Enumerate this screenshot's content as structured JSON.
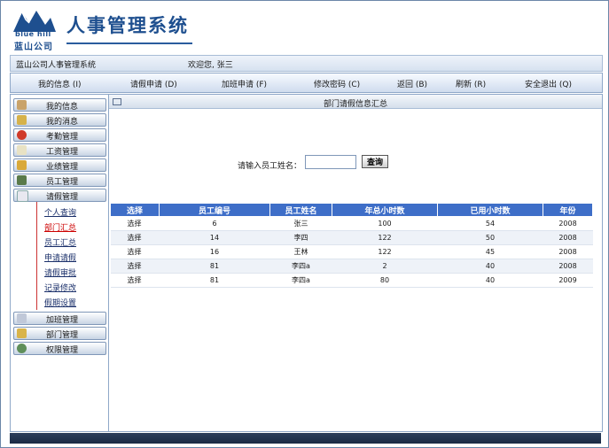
{
  "header": {
    "logo_en": "blue hill",
    "logo_cn": "蓝山公司",
    "title": "人事管理系统",
    "brand_color": "#1e4f8f"
  },
  "welcome": {
    "system_name": "蓝山公司人事管理系统",
    "greeting": "欢迎您, 张三"
  },
  "nav": [
    {
      "label": "我的信息 (I)"
    },
    {
      "label": "请假申请 (D)"
    },
    {
      "label": "加班申请 (F)"
    },
    {
      "label": "修改密码 (C)"
    },
    {
      "label": "返回 (B)"
    },
    {
      "label": "刷新 (R)"
    },
    {
      "label": "安全退出 (Q)"
    }
  ],
  "sidebar": {
    "menus_top": [
      {
        "label": "我的信息",
        "icon": "profile-icon"
      },
      {
        "label": "我的消息",
        "icon": "message-icon"
      },
      {
        "label": "考勤管理",
        "icon": "clock-icon"
      },
      {
        "label": "工资管理",
        "icon": "salary-icon"
      },
      {
        "label": "业绩管理",
        "icon": "performance-icon"
      },
      {
        "label": "员工管理",
        "icon": "staff-icon"
      },
      {
        "label": "请假管理",
        "icon": "leave-icon"
      }
    ],
    "sub_items": [
      {
        "label": "个人查询"
      },
      {
        "label": "部门汇总"
      },
      {
        "label": "员工汇总"
      },
      {
        "label": "申请请假"
      },
      {
        "label": "请假审批"
      },
      {
        "label": "记录修改"
      },
      {
        "label": "假期设置"
      }
    ],
    "active_sub": "部门汇总",
    "menus_bottom": [
      {
        "label": "加班管理",
        "icon": "overtime-icon"
      },
      {
        "label": "部门管理",
        "icon": "department-icon"
      },
      {
        "label": "权限管理",
        "icon": "permission-icon"
      }
    ]
  },
  "main": {
    "title": "部门请假信息汇总",
    "search_label": "请输入员工姓名：",
    "search_value": "",
    "search_button": "查询",
    "table": {
      "headers": [
        "选择",
        "员工编号",
        "员工姓名",
        "年总小时数",
        "已用小时数",
        "年份"
      ],
      "rows": [
        [
          "选择",
          "6",
          "张三",
          "100",
          "54",
          "2008"
        ],
        [
          "选择",
          "14",
          "李四",
          "122",
          "50",
          "2008"
        ],
        [
          "选择",
          "16",
          "王林",
          "122",
          "45",
          "2008"
        ],
        [
          "选择",
          "81",
          "李四a",
          "2",
          "40",
          "2008"
        ],
        [
          "选择",
          "81",
          "李四a",
          "80",
          "40",
          "2009"
        ]
      ],
      "header_color": "#3e6ec8"
    }
  }
}
